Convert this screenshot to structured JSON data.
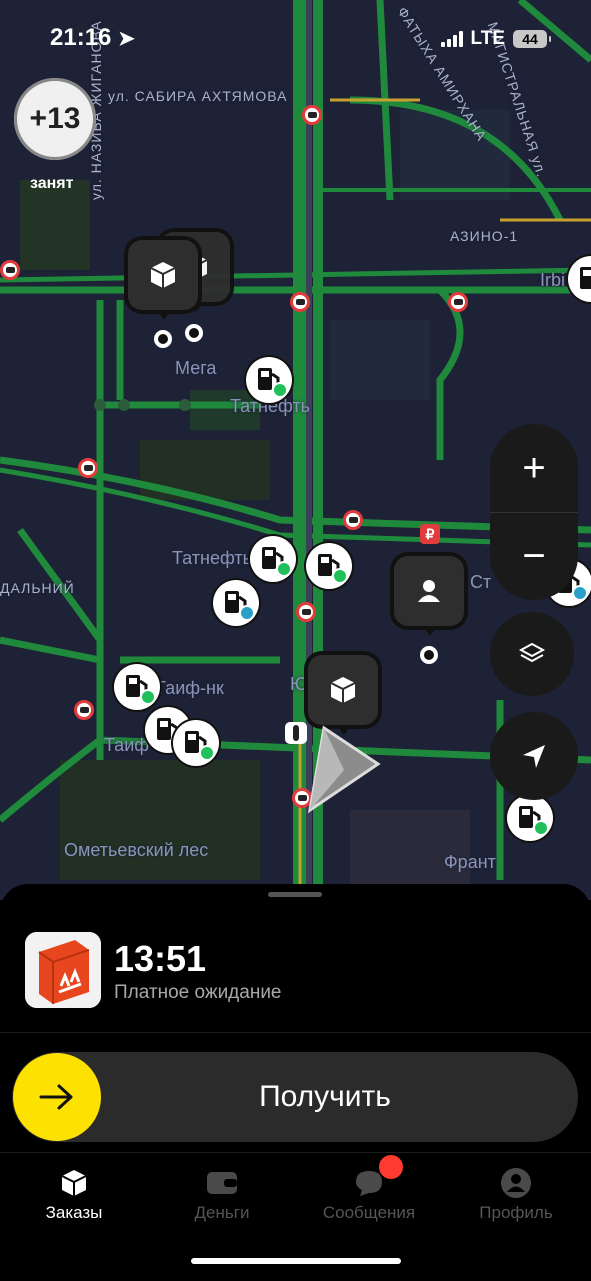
{
  "status_bar": {
    "time": "21:16",
    "network": "LTE",
    "battery": "44"
  },
  "busy_badge": {
    "count": "+13",
    "label": "занят"
  },
  "map": {
    "street_labels": {
      "sabira": "ул. САБИРА АХТЯМОВА",
      "nazib": "ул. НАЗИБА ЖИГАНОВА",
      "azino": "АЗИНО-1",
      "magistralnaya": "МАГИСТРАЛЬНАЯ ул.",
      "fatyha": "ФАТЫХА АМИРХАНА",
      "dalniy": "ДАЛЬНИЙ"
    },
    "place_labels": {
      "mega": "Мега",
      "tatneft1": "Татнефть",
      "tatneft2": "Татнефть",
      "taif_nk": "Таиф-нк",
      "taif": "Таиф",
      "ometievsky": "Ометьевский лес",
      "frant": "Франт",
      "irbis": "Irbi",
      "st": "Ст",
      "yu": "Ю"
    }
  },
  "map_controls": {
    "zoom_in": "+",
    "zoom_out": "−"
  },
  "order": {
    "timer": "13:51",
    "status": "Платное ожидание"
  },
  "action": {
    "receive_label": "Получить"
  },
  "tabs": [
    {
      "label": "Заказы",
      "icon": "box-icon",
      "active": true
    },
    {
      "label": "Деньги",
      "icon": "wallet-icon",
      "active": false
    },
    {
      "label": "Сообщения",
      "icon": "chat-icon",
      "active": false,
      "badge": true
    },
    {
      "label": "Профиль",
      "icon": "profile-icon",
      "active": false
    }
  ],
  "colors": {
    "accent": "#fde100",
    "notification": "#ff3b30",
    "road_green": "#1f8a3c",
    "map_bg": "#1d2236"
  }
}
